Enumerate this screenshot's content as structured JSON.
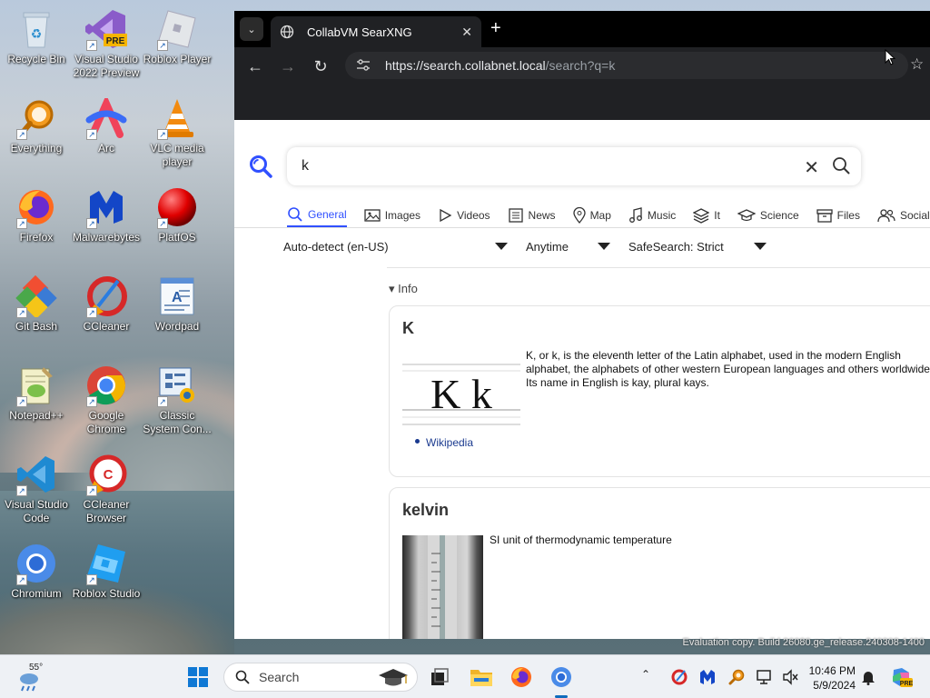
{
  "desktop": {
    "icons": [
      {
        "label": "Recycle Bin",
        "icon": "recycle-bin-icon"
      },
      {
        "label": "Visual Studio 2022 Preview",
        "icon": "visual-studio-preview-icon",
        "badge": "PRE"
      },
      {
        "label": "Roblox Player",
        "icon": "roblox-player-icon"
      },
      {
        "label": "Everything",
        "icon": "everything-search-icon"
      },
      {
        "label": "Arc",
        "icon": "arc-browser-icon"
      },
      {
        "label": "VLC media player",
        "icon": "vlc-cone-icon"
      },
      {
        "label": "Firefox",
        "icon": "firefox-icon"
      },
      {
        "label": "Malwarebytes",
        "icon": "malwarebytes-icon"
      },
      {
        "label": "PlatfOS",
        "icon": "red-sphere-icon"
      },
      {
        "label": "Git Bash",
        "icon": "git-bash-icon"
      },
      {
        "label": "CCleaner",
        "icon": "ccleaner-icon"
      },
      {
        "label": "Wordpad",
        "icon": "wordpad-icon"
      },
      {
        "label": "Notepad++",
        "icon": "notepadpp-icon"
      },
      {
        "label": "Google Chrome",
        "icon": "chrome-icon"
      },
      {
        "label": "Classic System Con...",
        "icon": "control-panel-icon"
      },
      {
        "label": "Visual Studio Code",
        "icon": "vscode-icon"
      },
      {
        "label": "CCleaner Browser",
        "icon": "ccleaner-browser-icon"
      },
      {
        "label": "Chromium",
        "icon": "chromium-icon"
      },
      {
        "label": "Roblox Studio",
        "icon": "roblox-studio-icon"
      }
    ],
    "watermark": "Evaluation copy. Build 26080.ge_release.240308-1400"
  },
  "browser": {
    "tab_title": "CollabVM SearXNG",
    "url_host": "https://search.collabnet.local",
    "url_path": "/search?q=k"
  },
  "search": {
    "query": "k",
    "categories": [
      {
        "label": "General",
        "icon": "search-icon",
        "active": true
      },
      {
        "label": "Images",
        "icon": "image-icon"
      },
      {
        "label": "Videos",
        "icon": "play-icon"
      },
      {
        "label": "News",
        "icon": "newspaper-icon"
      },
      {
        "label": "Map",
        "icon": "map-pin-icon"
      },
      {
        "label": "Music",
        "icon": "music-note-icon"
      },
      {
        "label": "It",
        "icon": "layers-icon"
      },
      {
        "label": "Science",
        "icon": "graduation-cap-icon"
      },
      {
        "label": "Files",
        "icon": "archive-icon"
      },
      {
        "label": "Social",
        "icon": "people-icon"
      }
    ],
    "filters": {
      "language": "Auto-detect (en-US)",
      "time": "Anytime",
      "safesearch": "SafeSearch: Strict"
    },
    "info_label": "Info",
    "infoboxes": [
      {
        "title": "K",
        "image_text": "K k",
        "description": "K, or k, is the eleventh letter of the Latin alphabet, used in the modern English alphabet, the alphabets of other western European languages and others worldwide. Its name in English is kay, plural kays.",
        "link": "Wikipedia"
      },
      {
        "title": "kelvin",
        "description": "SI unit of thermodynamic temperature"
      }
    ]
  },
  "taskbar": {
    "temperature": "55°",
    "search_placeholder": "Search",
    "time": "10:46 PM",
    "date": "5/9/2024"
  }
}
